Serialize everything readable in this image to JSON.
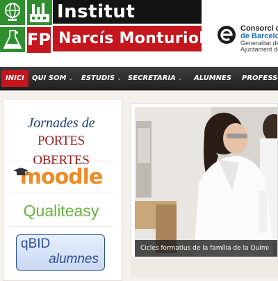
{
  "header": {
    "brand_line_1": "Institut",
    "brand_line_2": "Narcís Monturiol",
    "fp_label": "FP",
    "consorci": {
      "name": "Consorci d'E",
      "city": "de Barcelon",
      "gen": "Generalitat de",
      "ajt": "Ajuntament de"
    }
  },
  "nav": {
    "items": [
      {
        "label": "INICI",
        "active": true
      },
      {
        "label": "QUI SOM",
        "caret": "⌄"
      },
      {
        "label": "ESTUDIS",
        "caret": "⌄"
      },
      {
        "label": "SECRETARIA",
        "caret": "⌄"
      },
      {
        "label": "ALUMNES"
      },
      {
        "label": "PROFESSO"
      }
    ]
  },
  "sidebar": {
    "jornades_line1": "Jornades de",
    "jornades_line2": "PORTES OBERTES",
    "moodle": "moodle",
    "qualiteasy": "Qualiteasy",
    "qbid_title": "qBID",
    "qbid_sub": "alumnes"
  },
  "slider": {
    "caption": "Cicles formatius de la família de la Quími"
  },
  "colors": {
    "brand_red": "#c4161c",
    "brand_black": "#141414",
    "brand_green": "#2f8f2f",
    "nav_bg": "#2a2a2a",
    "moodle_orange": "#f08a24",
    "qualiteasy_green": "#6ab23e",
    "qbid_blue": "#2b4f95"
  }
}
